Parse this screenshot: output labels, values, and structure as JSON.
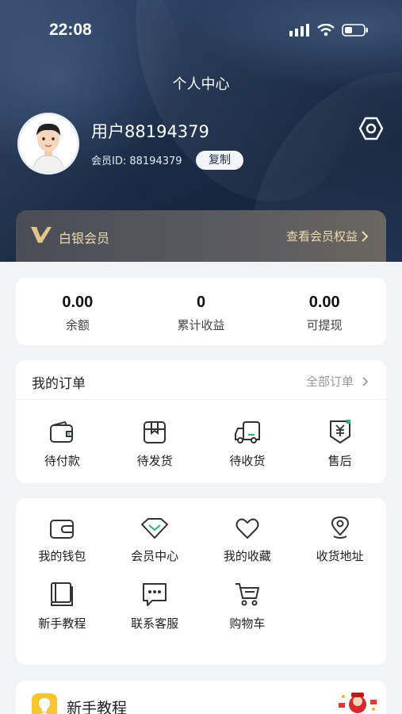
{
  "status_bar": {
    "time": "22:08"
  },
  "header": {
    "title": "个人中心"
  },
  "profile": {
    "username": "用户88194379",
    "member_id": "会员ID: 88194379",
    "copy_label": "复制"
  },
  "vip": {
    "level": "白银会员",
    "benefits_link": "查看会员权益",
    "badge_letter": "V"
  },
  "stats": [
    {
      "value": "0.00",
      "label": "余额"
    },
    {
      "value": "0",
      "label": "累计收益"
    },
    {
      "value": "0.00",
      "label": "可提现"
    }
  ],
  "orders": {
    "title": "我的订单",
    "all_label": "全部订单",
    "items": [
      {
        "label": "待付款",
        "icon": "wallet-icon"
      },
      {
        "label": "待发货",
        "icon": "package-icon"
      },
      {
        "label": "待收货",
        "icon": "truck-icon"
      },
      {
        "label": "售后",
        "icon": "refund-icon"
      }
    ]
  },
  "tools": {
    "items": [
      {
        "label": "我的钱包",
        "icon": "wallet-card-icon"
      },
      {
        "label": "会员中心",
        "icon": "diamond-icon"
      },
      {
        "label": "我的收藏",
        "icon": "heart-icon"
      },
      {
        "label": "收货地址",
        "icon": "location-pin-icon"
      },
      {
        "label": "新手教程",
        "icon": "book-icon"
      },
      {
        "label": "联系客服",
        "icon": "chat-bubble-icon"
      },
      {
        "label": "购物车",
        "icon": "cart-icon"
      }
    ]
  },
  "tutorial": {
    "title": "新手教程",
    "icon": "lightbulb-icon"
  },
  "colors": {
    "gold": "#efd9b0",
    "navy": "#1b2e4b",
    "tutorial_yellow": "#f7c531"
  }
}
